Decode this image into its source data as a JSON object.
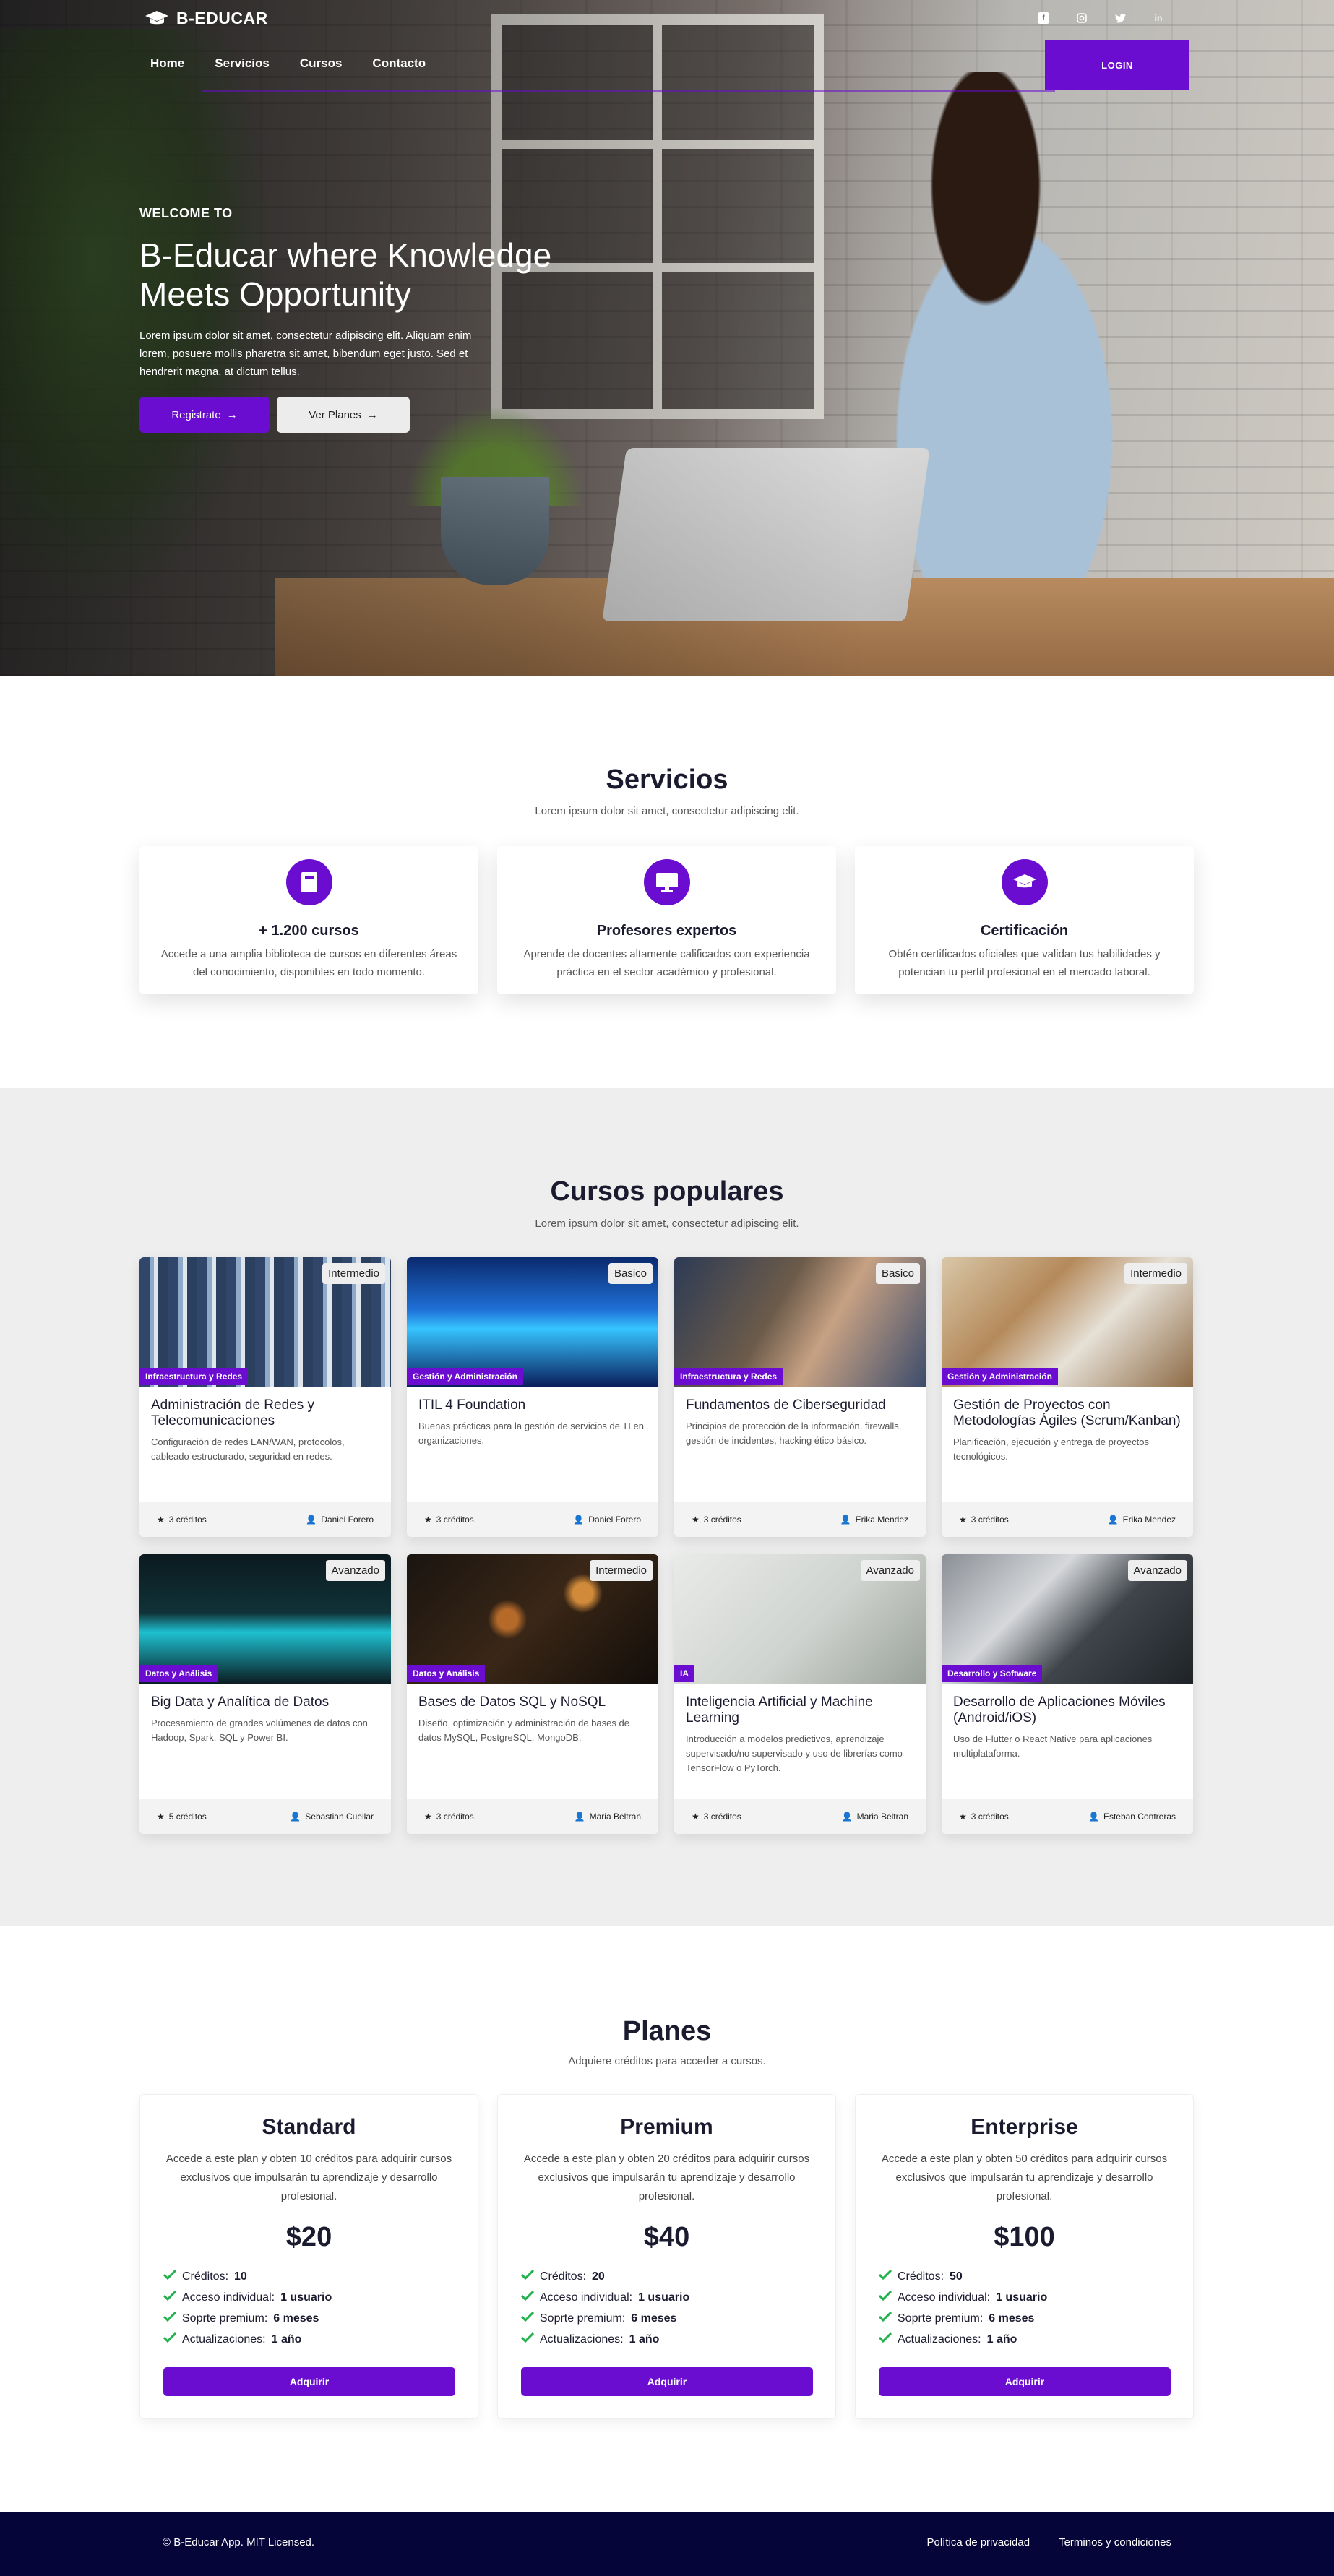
{
  "brand": {
    "name": "B-EDUCAR",
    "icon": "graduation-cap-icon"
  },
  "nav": {
    "items": [
      "Home",
      "Servicios",
      "Cursos",
      "Contacto"
    ],
    "login": "LOGIN"
  },
  "social": [
    "facebook-icon",
    "instagram-icon",
    "twitter-icon",
    "linkedin-icon"
  ],
  "hero": {
    "kicker": "WELCOME TO",
    "title": "B-Educar where Knowledge Meets Opportunity",
    "text": "Lorem ipsum dolor sit amet, consectetur adipiscing elit. Aliquam enim lorem, posuere mollis pharetra sit amet, bibendum eget justo. Sed et hendrerit magna, at dictum tellus.",
    "btn_primary": "Registrate",
    "btn_secondary": "Ver Planes"
  },
  "servicios": {
    "title": "Servicios",
    "subtitle": "Lorem ipsum dolor sit amet, consectetur adipiscing elit.",
    "items": [
      {
        "icon": "book-icon",
        "title": "+ 1.200 cursos",
        "text": "Accede a una amplia biblioteca de cursos en diferentes áreas del conocimiento, disponibles en todo momento."
      },
      {
        "icon": "monitor-icon",
        "title": "Profesores expertos",
        "text": "Aprende de docentes altamente calificados con experiencia práctica en el sector académico y profesional."
      },
      {
        "icon": "graduation-cap-icon",
        "title": "Certificación",
        "text": "Obtén certificados oficiales que validan tus habilidades y potencian tu perfil profesional en el mercado laboral."
      }
    ]
  },
  "cursos": {
    "title": "Cursos populares",
    "subtitle": "Lorem ipsum dolor sit amet, consectetur adipiscing elit.",
    "items": [
      {
        "level": "Intermedio",
        "category": "Infraestructura y Redes",
        "title": "Administración de Redes y Telecomunicaciones",
        "text": "Configuración de redes LAN/WAN, protocolos, cableado estructurado, seguridad en redes.",
        "credits": "3 créditos",
        "teacher": "Daniel Forero"
      },
      {
        "level": "Basico",
        "category": "Gestión y Administración",
        "title": "ITIL 4 Foundation",
        "text": "Buenas prácticas para la gestión de servicios de TI en organizaciones.",
        "credits": "3 créditos",
        "teacher": "Daniel Forero"
      },
      {
        "level": "Basico",
        "category": "Infraestructura y Redes",
        "title": "Fundamentos de Ciberseguridad",
        "text": "Principios de protección de la información, firewalls, gestión de incidentes, hacking ético básico.",
        "credits": "3 créditos",
        "teacher": "Erika Mendez"
      },
      {
        "level": "Intermedio",
        "category": "Gestión y Administración",
        "title": "Gestión de Proyectos con Metodologías Ágiles (Scrum/Kanban)",
        "text": "Planificación, ejecución y entrega de proyectos tecnológicos.",
        "credits": "3 créditos",
        "teacher": "Erika Mendez"
      },
      {
        "level": "Avanzado",
        "category": "Datos y Análisis",
        "title": "Big Data y Analítica de Datos",
        "text": "Procesamiento de grandes volúmenes de datos con Hadoop, Spark, SQL y Power BI.",
        "credits": "5 créditos",
        "teacher": "Sebastian Cuellar"
      },
      {
        "level": "Intermedio",
        "category": "Datos y Análisis",
        "title": "Bases de Datos SQL y NoSQL",
        "text": "Diseño, optimización y administración de bases de datos MySQL, PostgreSQL, MongoDB.",
        "credits": "3 créditos",
        "teacher": "Maria Beltran"
      },
      {
        "level": "Avanzado",
        "category": "IA",
        "title": "Inteligencia Artificial y Machine Learning",
        "text": "Introducción a modelos predictivos, aprendizaje supervisado/no supervisado y uso de librerías como TensorFlow o PyTorch.",
        "credits": "3 créditos",
        "teacher": "Maria Beltran"
      },
      {
        "level": "Avanzado",
        "category": "Desarrollo y Software",
        "title": "Desarrollo de Aplicaciones Móviles (Android/iOS)",
        "text": "Uso de Flutter o React Native para aplicaciones multiplataforma.",
        "credits": "3 créditos",
        "teacher": "Esteban Contreras"
      }
    ]
  },
  "planes": {
    "title": "Planes",
    "subtitle": "Adquiere créditos para acceder a cursos.",
    "items": [
      {
        "name": "Standard",
        "desc": "Accede a este plan y obten 10 créditos para adquirir cursos exclusivos que impulsarán tu aprendizaje y desarrollo profesional.",
        "price": "$20",
        "features": [
          [
            "Créditos:",
            "10"
          ],
          [
            "Acceso individual:",
            "1 usuario"
          ],
          [
            "Soprte premium:",
            "6 meses"
          ],
          [
            "Actualizaciones:",
            "1 año"
          ]
        ],
        "button": "Adquirir"
      },
      {
        "name": "Premium",
        "desc": "Accede a este plan y obten 20 créditos para adquirir cursos exclusivos que impulsarán tu aprendizaje y desarrollo profesional.",
        "price": "$40",
        "features": [
          [
            "Créditos:",
            "20"
          ],
          [
            "Acceso individual:",
            "1 usuario"
          ],
          [
            "Soprte premium:",
            "6 meses"
          ],
          [
            "Actualizaciones:",
            "1 año"
          ]
        ],
        "button": "Adquirir"
      },
      {
        "name": "Enterprise",
        "desc": "Accede a este plan y obten 50 créditos para adquirir cursos exclusivos que impulsarán tu aprendizaje y desarrollo profesional.",
        "price": "$100",
        "features": [
          [
            "Créditos:",
            "50"
          ],
          [
            "Acceso individual:",
            "1 usuario"
          ],
          [
            "Soprte premium:",
            "6 meses"
          ],
          [
            "Actualizaciones:",
            "1 año"
          ]
        ],
        "button": "Adquirir"
      }
    ]
  },
  "footer": {
    "copy": "© B-Educar App. MIT Licensed.",
    "links": [
      "Política de privacidad",
      "Terminos y condiciones"
    ]
  },
  "colors": {
    "accent": "#6a0dd0",
    "footer_bg": "#05053a",
    "check": "#22b14c"
  }
}
